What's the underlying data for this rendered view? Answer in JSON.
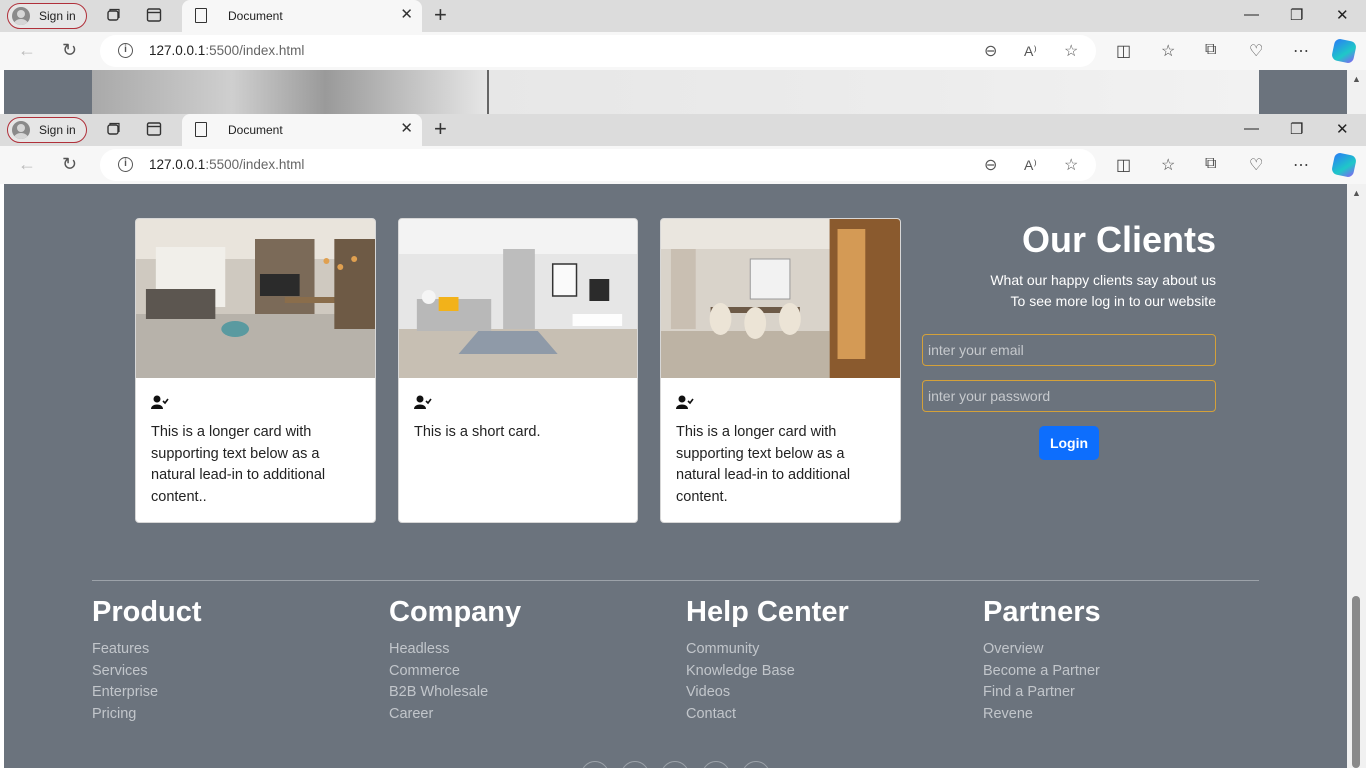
{
  "browser": {
    "signin_label": "Sign in",
    "tab_title": "Document",
    "url_host": "127.0.0.1",
    "url_rest": ":5500/index.html"
  },
  "cards": [
    {
      "text": "This is a longer card with supporting text below as a natural lead-in to additional content.."
    },
    {
      "text": "This is a short card."
    },
    {
      "text": "This is a longer card with supporting text below as a natural lead-in to additional content."
    }
  ],
  "clients": {
    "title": "Our Clients",
    "line1": "What our happy clients say about us",
    "line2": "To see more log in to our website",
    "email_placeholder": "inter your email",
    "password_placeholder": "inter your password",
    "login_label": "Login"
  },
  "footer": {
    "columns": [
      {
        "title": "Product",
        "links": [
          "Features",
          "Services",
          "Enterprise",
          "Pricing"
        ]
      },
      {
        "title": "Company",
        "links": [
          "Headless",
          "Commerce",
          "B2B Wholesale",
          "Career"
        ]
      },
      {
        "title": "Help Center",
        "links": [
          "Community",
          "Knowledge Base",
          "Videos",
          "Contact"
        ]
      },
      {
        "title": "Partners",
        "links": [
          "Overview",
          "Become a Partner",
          "Find a Partner",
          "Revene"
        ]
      }
    ]
  },
  "colors": {
    "page_bg": "#6b737d",
    "accent": "#0d6efd",
    "input_border": "#d4a13a"
  }
}
